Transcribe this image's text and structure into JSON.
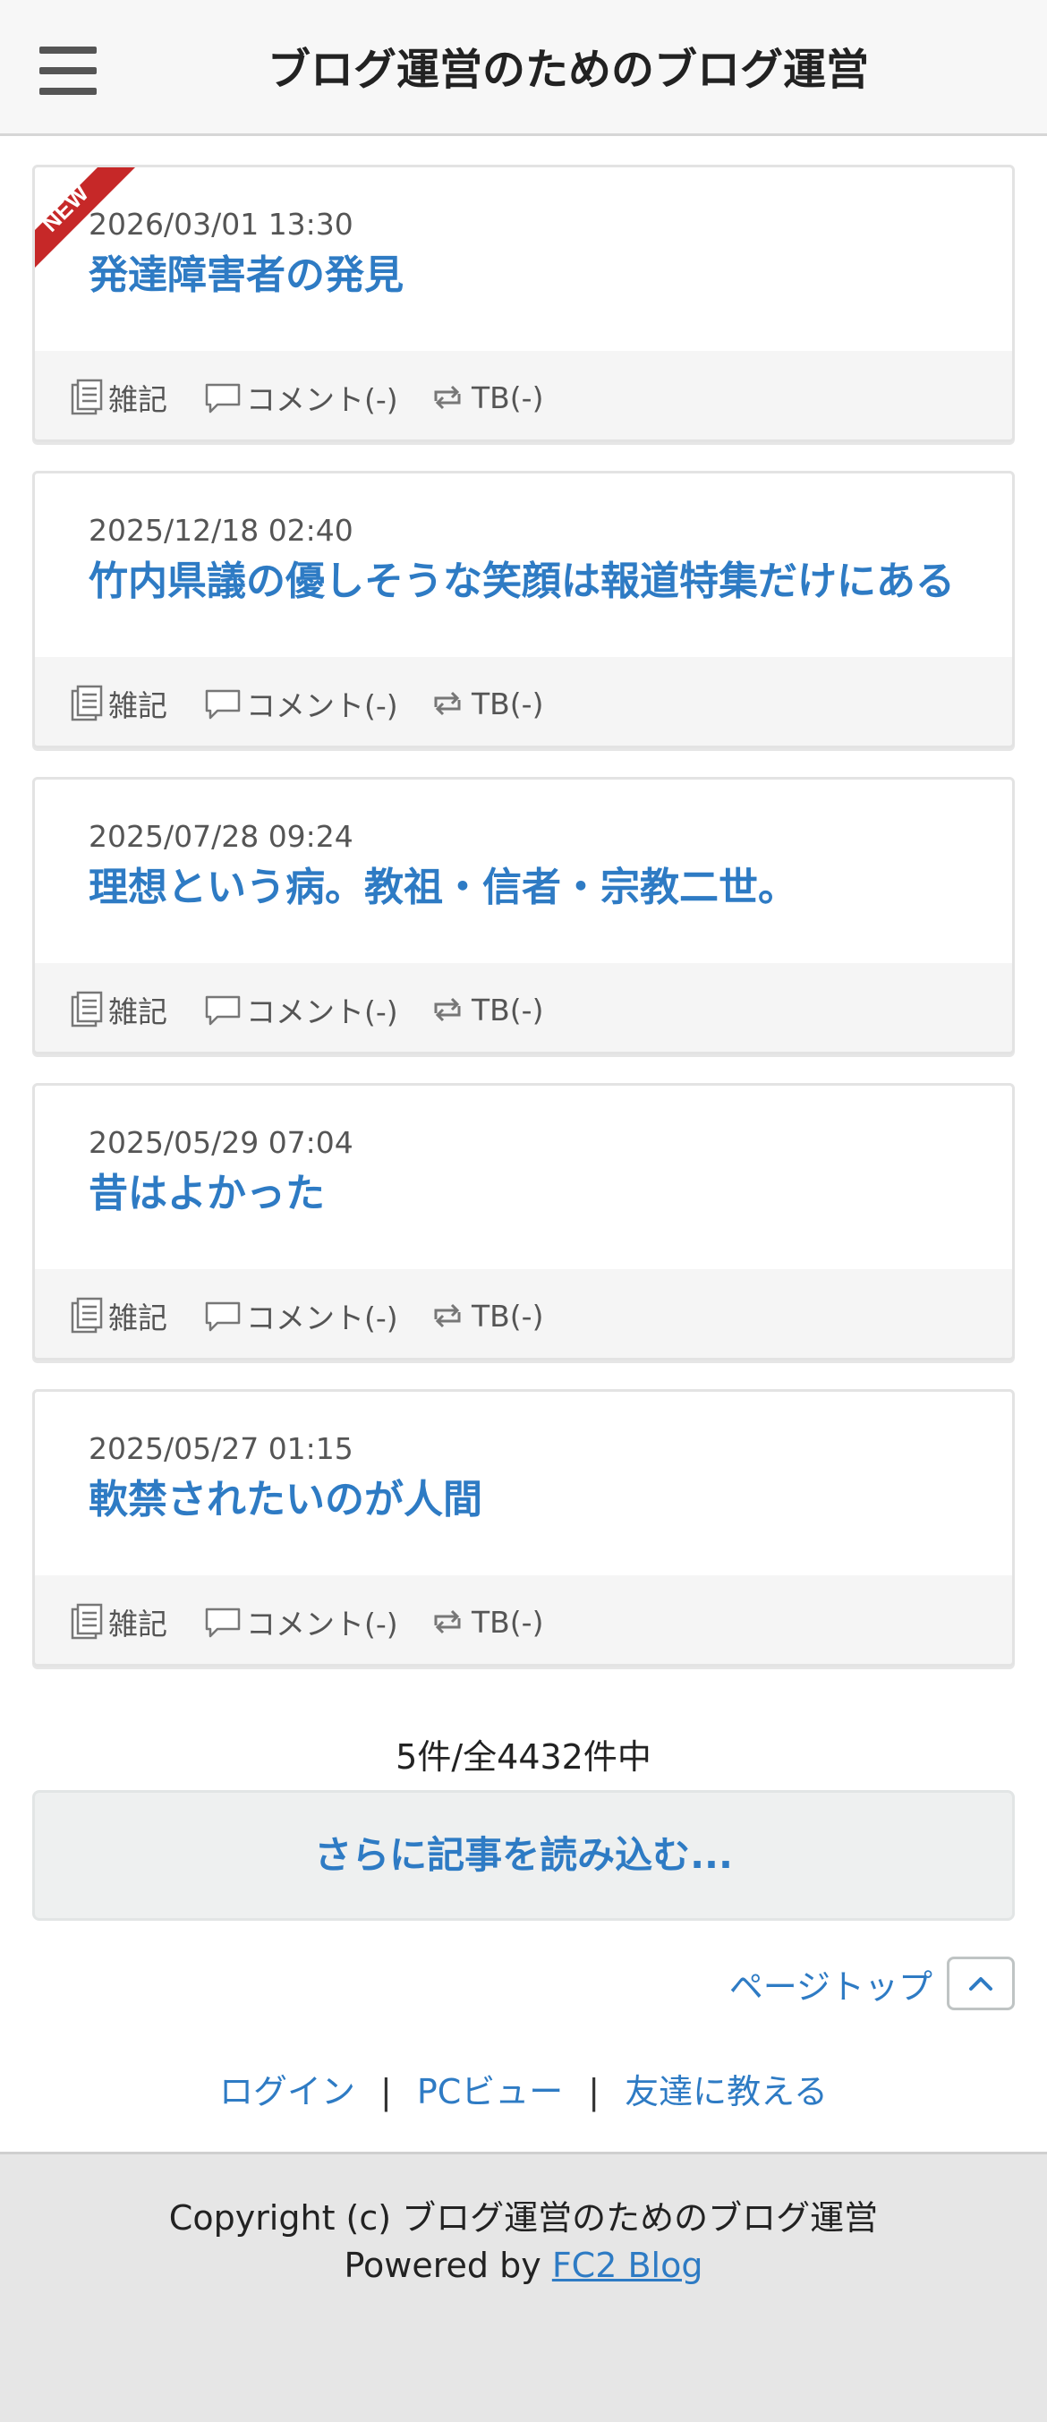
{
  "header": {
    "title": "ブログ運営のためのブログ運営",
    "menu_icon": "hamburger-menu-icon"
  },
  "new_badge": "NEW",
  "articles": [
    {
      "date": "2026/03/01 13:30",
      "title": "発達障害者の発見",
      "category": "雑記",
      "comment": "コメント(-)",
      "tb": "TB(-)",
      "is_new": true
    },
    {
      "date": "2025/12/18 02:40",
      "title": "竹内県議の優しそうな笑顔は報道特集だけにある",
      "category": "雑記",
      "comment": "コメント(-)",
      "tb": "TB(-)"
    },
    {
      "date": "2025/07/28 09:24",
      "title": "理想という病。教祖・信者・宗教二世。",
      "category": "雑記",
      "comment": "コメント(-)",
      "tb": "TB(-)"
    },
    {
      "date": "2025/05/29 07:04",
      "title": "昔はよかった",
      "category": "雑記",
      "comment": "コメント(-)",
      "tb": "TB(-)"
    },
    {
      "date": "2025/05/27 01:15",
      "title": "軟禁されたいのが人間",
      "category": "雑記",
      "comment": "コメント(-)",
      "tb": "TB(-)"
    }
  ],
  "pagination": {
    "count_text": "5件/全4432件中",
    "more_label": "さらに記事を読み込む..."
  },
  "pagetop": {
    "label": "ページトップ",
    "icon": "chevron-up-icon"
  },
  "links": {
    "login": "ログイン",
    "pc_view": "PCビュー",
    "tell_friend": "友達に教える",
    "separator": "|"
  },
  "footer": {
    "copyright": "Copyright (c) ブログ運営のためのブログ運営",
    "powered_prefix": "Powered by ",
    "powered_link": "FC2 Blog"
  },
  "colors": {
    "link": "#2e7bc4",
    "ribbon": "#c62828",
    "footer_bg": "#e6e6e6",
    "meta_bg": "#f5f5f5"
  }
}
